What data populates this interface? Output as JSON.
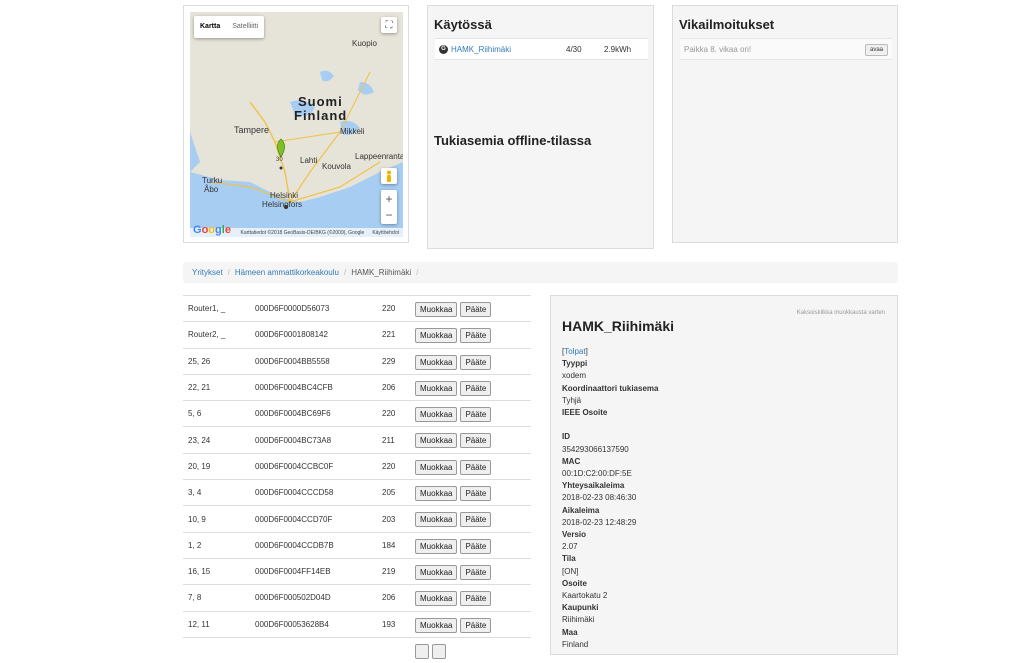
{
  "map": {
    "tab_map": "Kartta",
    "tab_satellite": "Satelliitti",
    "zoom_in": "+",
    "zoom_out": "−",
    "fullscreen_icon": "fullscreen-icon",
    "marker_label": "30",
    "labels": {
      "country_fi": "Suomi",
      "country_en": "Finland",
      "kuopio": "Kuopio",
      "tampere": "Tampere",
      "mikkeli": "Mikkeli",
      "lahti": "Lahti",
      "kouvola": "Kouvola",
      "lappeenranta": "Lappeenranta",
      "turku": "Turku",
      "abo": "Åbo",
      "helsinki": "Helsinki",
      "helsingfors": "Helsingfors"
    },
    "attribution": "Karttatiedot ©2018 GeoBasis-DE/BKG (©2009), Google",
    "terms": "Käyttöehdot",
    "google": [
      "G",
      "o",
      "o",
      "g",
      "l",
      "e"
    ]
  },
  "kaytossa": {
    "title": "Käytössä",
    "row": {
      "icon_letter": "G",
      "name": "HAMK_Riihimäki",
      "count": "4/30",
      "energy": "2.9kWh"
    },
    "offline_title": "Tukiasemia offline-tilassa"
  },
  "vika": {
    "title": "Vikailmoitukset",
    "row_text": "Paikka 8. vikaa on!",
    "open_label": "avaa"
  },
  "breadcrumb": {
    "items": [
      "Yritykset",
      "Hämeen ammattikorkeakoulu"
    ],
    "current": "HAMK_Riihimäki",
    "sep": "/"
  },
  "devices": {
    "edit_label": "Muokkaa",
    "terminal_label": "Pääte",
    "rows": [
      {
        "name": "Router1, _",
        "id": "000D6F0000D56073",
        "value": "220"
      },
      {
        "name": "Router2, _",
        "id": "000D6F0001808142",
        "value": "221"
      },
      {
        "name": "25, 26",
        "id": "000D6F0004BB5558",
        "value": "229"
      },
      {
        "name": "22, 21",
        "id": "000D6F0004BC4CFB",
        "value": "206"
      },
      {
        "name": "5, 6",
        "id": "000D6F0004BC69F6",
        "value": "220"
      },
      {
        "name": "23, 24",
        "id": "000D6F0004BC73A8",
        "value": "211"
      },
      {
        "name": "20, 19",
        "id": "000D6F0004CCBC0F",
        "value": "220"
      },
      {
        "name": "3, 4",
        "id": "000D6F0004CCCD58",
        "value": "205"
      },
      {
        "name": "10, 9",
        "id": "000D6F0004CCD70F",
        "value": "203"
      },
      {
        "name": "1, 2",
        "id": "000D6F0004CCDB7B",
        "value": "184"
      },
      {
        "name": "16, 15",
        "id": "000D6F0004FF14EB",
        "value": "219"
      },
      {
        "name": "7, 8",
        "id": "000D6F000502D04D",
        "value": "206"
      },
      {
        "name": "12, 11",
        "id": "000D6F00053628B4",
        "value": "193"
      }
    ]
  },
  "detail": {
    "hint": "Kaksoisklikka muokkausta varten",
    "title": "HAMK_Riihimäki",
    "columns_link": "Tolpat",
    "tyyppi_label": "Tyyppi",
    "tyyppi_value": "xodem",
    "koordinaattori_label": "Koordinaattori tukiasema",
    "koordinaattori_value": "Tyhjä",
    "ieee_label": "IEEE Osoite",
    "id_label": "ID",
    "id_value": "354293066137590",
    "mac_label": "MAC",
    "mac_value": "00:1D:C2:00:DF:5E",
    "yhteys_label": "Yhteysaikaleima",
    "yhteys_value": "2018-02-23 08:46:30",
    "aika_label": "Aikaleima",
    "aika_value": "2018-02-23 12:48:29",
    "versio_label": "Versio",
    "versio_value": "2.07",
    "tila_label": "Tila",
    "tila_value": "[ON]",
    "osoite_label": "Osoite",
    "osoite_value": "Kaartokatu 2",
    "kaupunki_label": "Kaupunki",
    "kaupunki_value": "Riihimäki",
    "maa_label": "Maa",
    "maa_value": "Finland"
  }
}
